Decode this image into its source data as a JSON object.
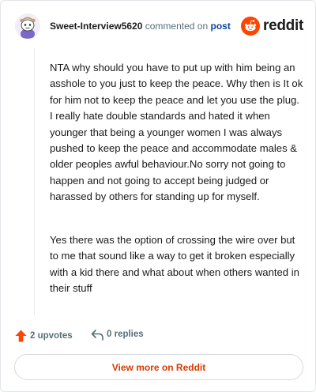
{
  "header": {
    "username": "Sweet-Interview5620",
    "action_text": "commented on",
    "post_link": "post",
    "logo_text": "reddit",
    "avatar_icon": "snoo-avatar-icon",
    "logo_icon": "reddit-alien-icon"
  },
  "comment": {
    "paragraphs": [
      "NTA why should you have to put up with him being an asshole to you just to keep the peace. Why then is It ok for him not to keep the peace and let you use the plug. I really hate double standards and hated it when younger that being a younger women I was always pushed to keep the peace and accommodate males & older peoples awful behaviour.No sorry not going to happen and not going to accept being judged or harassed by others for standing up for myself.",
      "Yes there was the option of crossing the wire over but to me that sound like a way to get it broken especially with a kid there and what about when others wanted in their stuff"
    ]
  },
  "footer": {
    "upvotes_label": "2 upvotes",
    "replies_label": "0 replies",
    "upvote_icon": "upvote-arrow-icon",
    "reply_icon": "reply-arrow-icon"
  },
  "actions": {
    "view_more_label": "View more on Reddit"
  },
  "colors": {
    "accent": "#d93900",
    "reddit_orange": "#ff4500",
    "upvote": "#ff4500",
    "link": "#0a449b",
    "muted": "#576f76"
  }
}
